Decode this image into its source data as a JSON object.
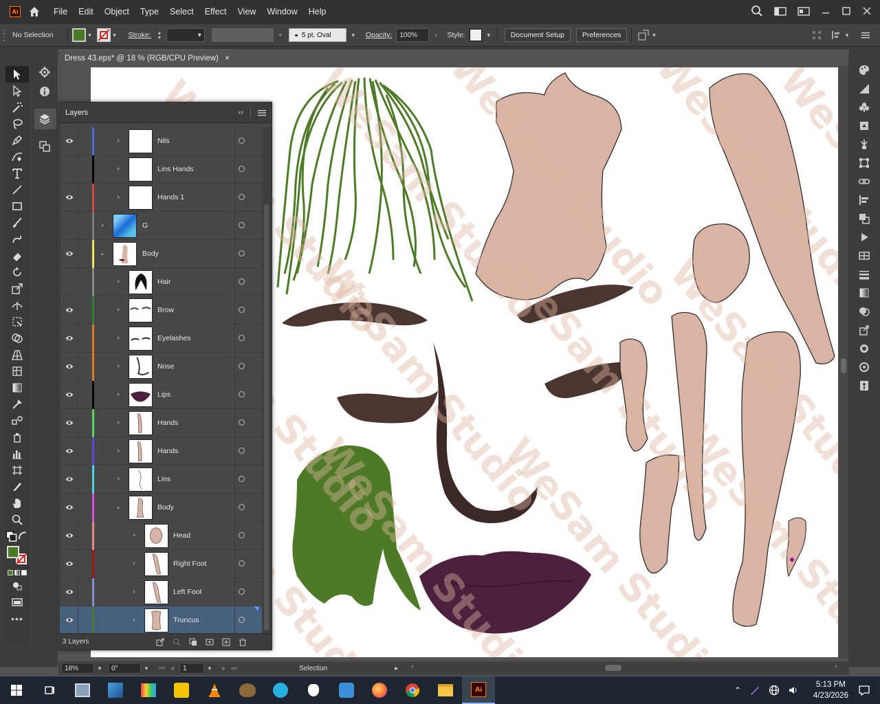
{
  "menubar": {
    "app_icon": "Ai",
    "items": [
      "File",
      "Edit",
      "Object",
      "Type",
      "Select",
      "Effect",
      "View",
      "Window",
      "Help"
    ]
  },
  "control": {
    "selection_label": "No Selection",
    "fill_color": "#4e7a27",
    "stroke_label": "Stroke:",
    "brush_label": "5 pt. Oval",
    "opacity_label": "Opacity:",
    "opacity_value": "100%",
    "style_label": "Style:",
    "document_setup": "Document Setup",
    "preferences": "Preferences"
  },
  "document": {
    "tab_title": "Dress 43.eps* @ 18 % (RGB/CPU Preview)",
    "close": "×"
  },
  "layers_panel": {
    "title": "Layers",
    "footer_count": "3 Layers",
    "rows": [
      {
        "name": "Nils",
        "visible": true,
        "color": "#4b6ed6",
        "indent": 1,
        "expanded": false,
        "thumb": "blank"
      },
      {
        "name": "Lins Hands",
        "visible": false,
        "color": "#000000",
        "indent": 1,
        "expanded": false,
        "thumb": "blank"
      },
      {
        "name": "Hands 1",
        "visible": true,
        "color": "#d64545",
        "indent": 1,
        "expanded": false,
        "thumb": "blank"
      },
      {
        "name": "G",
        "visible": false,
        "color": "#7a7a7a",
        "indent": 0,
        "expanded": false,
        "thumb": "blue"
      },
      {
        "name": "Body",
        "visible": true,
        "color": "#f0e35a",
        "indent": 0,
        "expanded": true,
        "thumb": "body"
      },
      {
        "name": "Hair",
        "visible": false,
        "color": "#8a8a8a",
        "indent": 1,
        "expanded": false,
        "thumb": "hair"
      },
      {
        "name": "Brow",
        "visible": true,
        "color": "#2f7d2f",
        "indent": 1,
        "expanded": false,
        "thumb": "brow"
      },
      {
        "name": "Eyelashes",
        "visible": true,
        "color": "#e07a22",
        "indent": 1,
        "expanded": false,
        "thumb": "lash"
      },
      {
        "name": "Nose",
        "visible": true,
        "color": "#e07a22",
        "indent": 1,
        "expanded": false,
        "thumb": "nose"
      },
      {
        "name": "Lips",
        "visible": true,
        "color": "#000000",
        "indent": 1,
        "expanded": false,
        "thumb": "lips"
      },
      {
        "name": "Hands",
        "visible": true,
        "color": "#5fd35f",
        "indent": 1,
        "expanded": false,
        "thumb": "hand"
      },
      {
        "name": "Hands",
        "visible": true,
        "color": "#5a4ad6",
        "indent": 1,
        "expanded": false,
        "thumb": "hand"
      },
      {
        "name": "Lins",
        "visible": true,
        "color": "#4fd6e0",
        "indent": 1,
        "expanded": false,
        "thumb": "lins"
      },
      {
        "name": "Body",
        "visible": true,
        "color": "#d64fd6",
        "indent": 1,
        "expanded": true,
        "thumb": "bodyline"
      },
      {
        "name": "Head",
        "visible": true,
        "color": "#e08a8a",
        "indent": 2,
        "expanded": false,
        "thumb": "head"
      },
      {
        "name": "Right Foot",
        "visible": true,
        "color": "#a01818",
        "indent": 2,
        "expanded": false,
        "thumb": "leg"
      },
      {
        "name": "Left Foot",
        "visible": true,
        "color": "#8a8ad6",
        "indent": 2,
        "expanded": false,
        "thumb": "leg"
      },
      {
        "name": "Truncus",
        "visible": true,
        "color": "#4e7a27",
        "indent": 2,
        "expanded": false,
        "thumb": "torso",
        "selected": true
      }
    ]
  },
  "status": {
    "zoom": "18%",
    "rotation": "0°",
    "artboard": "1",
    "tool": "Selection"
  },
  "taskbar": {
    "time": "5:13 PM",
    "date": "4/23/2026"
  },
  "watermark": "WeSam Studio",
  "colors": {
    "skin": "#d9b4a4",
    "hair_green": "#4e7a27",
    "brow_brown": "#4a3531",
    "lips_purple": "#4f1f3e",
    "nose_brown": "#3d2a28"
  }
}
